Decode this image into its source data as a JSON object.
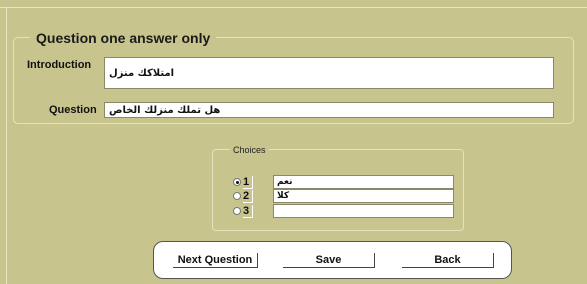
{
  "group_question": {
    "title": "Question one answer only",
    "introduction_label": "Introduction",
    "introduction_value": "امتلاكك منزل",
    "question_label": "Question",
    "question_value": "هل تملك منزلك الخاص"
  },
  "choices": {
    "title": "Choices",
    "items": [
      {
        "number": "1",
        "value": "نعم",
        "selected": true
      },
      {
        "number": "2",
        "value": "كلا",
        "selected": false
      },
      {
        "number": "3",
        "value": "",
        "selected": false
      }
    ]
  },
  "buttons": {
    "next": "Next Question",
    "save": "Save",
    "back": "Back"
  }
}
